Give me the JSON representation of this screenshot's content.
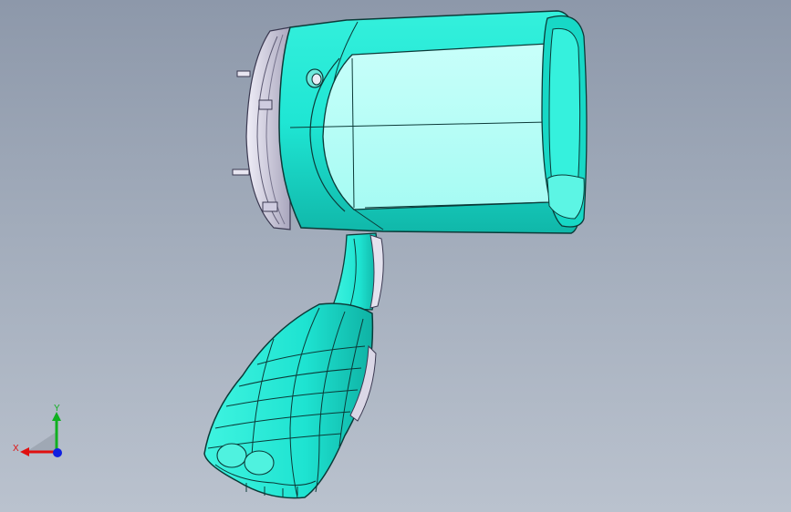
{
  "viewport": {
    "model": "spotlight-assembly",
    "colors": {
      "body": "#1fe6d4",
      "body_dark": "#11b8aa",
      "lens": "#b8fff8",
      "edge": "#0b3a38",
      "metal": "#d9d6e8",
      "metal_dark": "#8c8aa0"
    }
  },
  "triad": {
    "x_label": "X",
    "y_label": "Y",
    "x_color": "#e01010",
    "y_color": "#10b020",
    "z_color": "#1020e0"
  }
}
